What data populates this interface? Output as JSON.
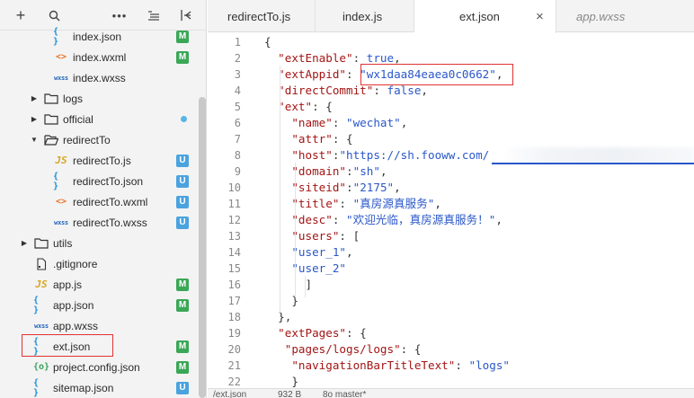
{
  "toolbar": {
    "icons": [
      "plus-icon",
      "search-icon",
      "more-icon",
      "outline-icon",
      "collapse-icon"
    ]
  },
  "tree": [
    {
      "label": "index.json",
      "icon": "json",
      "badge": "M",
      "indent": 2
    },
    {
      "label": "index.wxml",
      "icon": "wxml",
      "badge": "M",
      "indent": 2
    },
    {
      "label": "index.wxss",
      "icon": "wxss",
      "badge": "",
      "indent": 2
    },
    {
      "label": "logs",
      "icon": "folder",
      "arrow": "right",
      "badge": "",
      "indent": 1
    },
    {
      "label": "official",
      "icon": "folder",
      "arrow": "right",
      "badge": "",
      "dot": true,
      "indent": 1
    },
    {
      "label": "redirectTo",
      "icon": "folder-open",
      "arrow": "down",
      "badge": "",
      "indent": 1
    },
    {
      "label": "redirectTo.js",
      "icon": "js",
      "badge": "U",
      "indent": 2
    },
    {
      "label": "redirectTo.json",
      "icon": "json",
      "badge": "U",
      "indent": 2
    },
    {
      "label": "redirectTo.wxml",
      "icon": "wxml",
      "badge": "U",
      "indent": 2
    },
    {
      "label": "redirectTo.wxss",
      "icon": "wxss",
      "badge": "U",
      "indent": 2
    },
    {
      "label": "utils",
      "icon": "folder",
      "arrow": "right",
      "badge": "",
      "indent": 0
    },
    {
      "label": ".gitignore",
      "icon": "file",
      "badge": "",
      "indent": 0
    },
    {
      "label": "app.js",
      "icon": "js",
      "badge": "M",
      "indent": 0
    },
    {
      "label": "app.json",
      "icon": "json",
      "badge": "M",
      "indent": 0
    },
    {
      "label": "app.wxss",
      "icon": "wxss",
      "badge": "",
      "indent": 0
    },
    {
      "label": "ext.json",
      "icon": "json",
      "badge": "M",
      "indent": 0,
      "selected": true
    },
    {
      "label": "project.config.json",
      "icon": "cfg",
      "badge": "M",
      "indent": 0
    },
    {
      "label": "sitemap.json",
      "icon": "json",
      "badge": "U",
      "indent": 0
    }
  ],
  "tabs": [
    {
      "label": "redirectTo.js",
      "active": false,
      "italic": false
    },
    {
      "label": "index.js",
      "active": false,
      "italic": false
    },
    {
      "label": "ext.json",
      "active": true,
      "italic": false,
      "close": "×"
    },
    {
      "label": "app.wxss",
      "active": false,
      "italic": true
    }
  ],
  "editor": {
    "lines": [
      [
        [
          "p",
          "{"
        ]
      ],
      [
        [
          "p",
          "  "
        ],
        [
          "k",
          "\"extEnable\""
        ],
        [
          "p",
          ": "
        ],
        [
          "b",
          "true"
        ],
        [
          "p",
          ","
        ]
      ],
      [
        [
          "p",
          "  "
        ],
        [
          "k",
          "\"extAppid\""
        ],
        [
          "p",
          ": "
        ],
        [
          "s",
          "\"wx1daa84eaea0c0662\""
        ],
        [
          "p",
          ","
        ]
      ],
      [
        [
          "p",
          "  "
        ],
        [
          "k",
          "\"directCommit\""
        ],
        [
          "p",
          ": "
        ],
        [
          "b",
          "false"
        ],
        [
          "p",
          ","
        ]
      ],
      [
        [
          "p",
          "  "
        ],
        [
          "k",
          "\"ext\""
        ],
        [
          "p",
          ": {"
        ]
      ],
      [
        [
          "p",
          "    "
        ],
        [
          "k",
          "\"name\""
        ],
        [
          "p",
          ": "
        ],
        [
          "s",
          "\"wechat\""
        ],
        [
          "p",
          ","
        ]
      ],
      [
        [
          "p",
          "    "
        ],
        [
          "k",
          "\"attr\""
        ],
        [
          "p",
          ": {"
        ]
      ],
      [
        [
          "p",
          "    "
        ],
        [
          "k",
          "\"host\""
        ],
        [
          "p",
          ":"
        ],
        [
          "s",
          "\"https://sh.fooww.com/"
        ]
      ],
      [
        [
          "p",
          "    "
        ],
        [
          "k",
          "\"domain\""
        ],
        [
          "p",
          ":"
        ],
        [
          "s",
          "\"sh\""
        ],
        [
          "p",
          ","
        ]
      ],
      [
        [
          "p",
          "    "
        ],
        [
          "k",
          "\"siteid\""
        ],
        [
          "p",
          ":"
        ],
        [
          "s",
          "\"2175\""
        ],
        [
          "p",
          ","
        ]
      ],
      [
        [
          "p",
          "    "
        ],
        [
          "k",
          "\"title\""
        ],
        [
          "p",
          ": "
        ],
        [
          "s",
          "\"真房源真服务\""
        ],
        [
          "p",
          ","
        ]
      ],
      [
        [
          "p",
          "    "
        ],
        [
          "k",
          "\"desc\""
        ],
        [
          "p",
          ": "
        ],
        [
          "s",
          "\"欢迎光临，真房源真服务！\""
        ],
        [
          "p",
          ","
        ]
      ],
      [
        [
          "p",
          "    "
        ],
        [
          "k",
          "\"users\""
        ],
        [
          "p",
          ": ["
        ]
      ],
      [
        [
          "p",
          "    "
        ],
        [
          "s",
          "\"user_1\""
        ],
        [
          "p",
          ","
        ]
      ],
      [
        [
          "p",
          "    "
        ],
        [
          "s",
          "\"user_2\""
        ]
      ],
      [
        [
          "p",
          "      ]"
        ]
      ],
      [
        [
          "p",
          "    }"
        ]
      ],
      [
        [
          "p",
          "  },"
        ]
      ],
      [
        [
          "p",
          "  "
        ],
        [
          "k",
          "\"extPages\""
        ],
        [
          "p",
          ": {"
        ]
      ],
      [
        [
          "p",
          "   "
        ],
        [
          "k",
          "\"pages/logs/logs\""
        ],
        [
          "p",
          ": {"
        ]
      ],
      [
        [
          "p",
          "    "
        ],
        [
          "k",
          "\"navigationBarTitleText\""
        ],
        [
          "p",
          ": "
        ],
        [
          "s",
          "\"logs\""
        ]
      ],
      [
        [
          "p",
          "    }"
        ]
      ]
    ]
  },
  "status": {
    "file": "/ext.json",
    "size": "932 B",
    "branch": "8o master*"
  }
}
